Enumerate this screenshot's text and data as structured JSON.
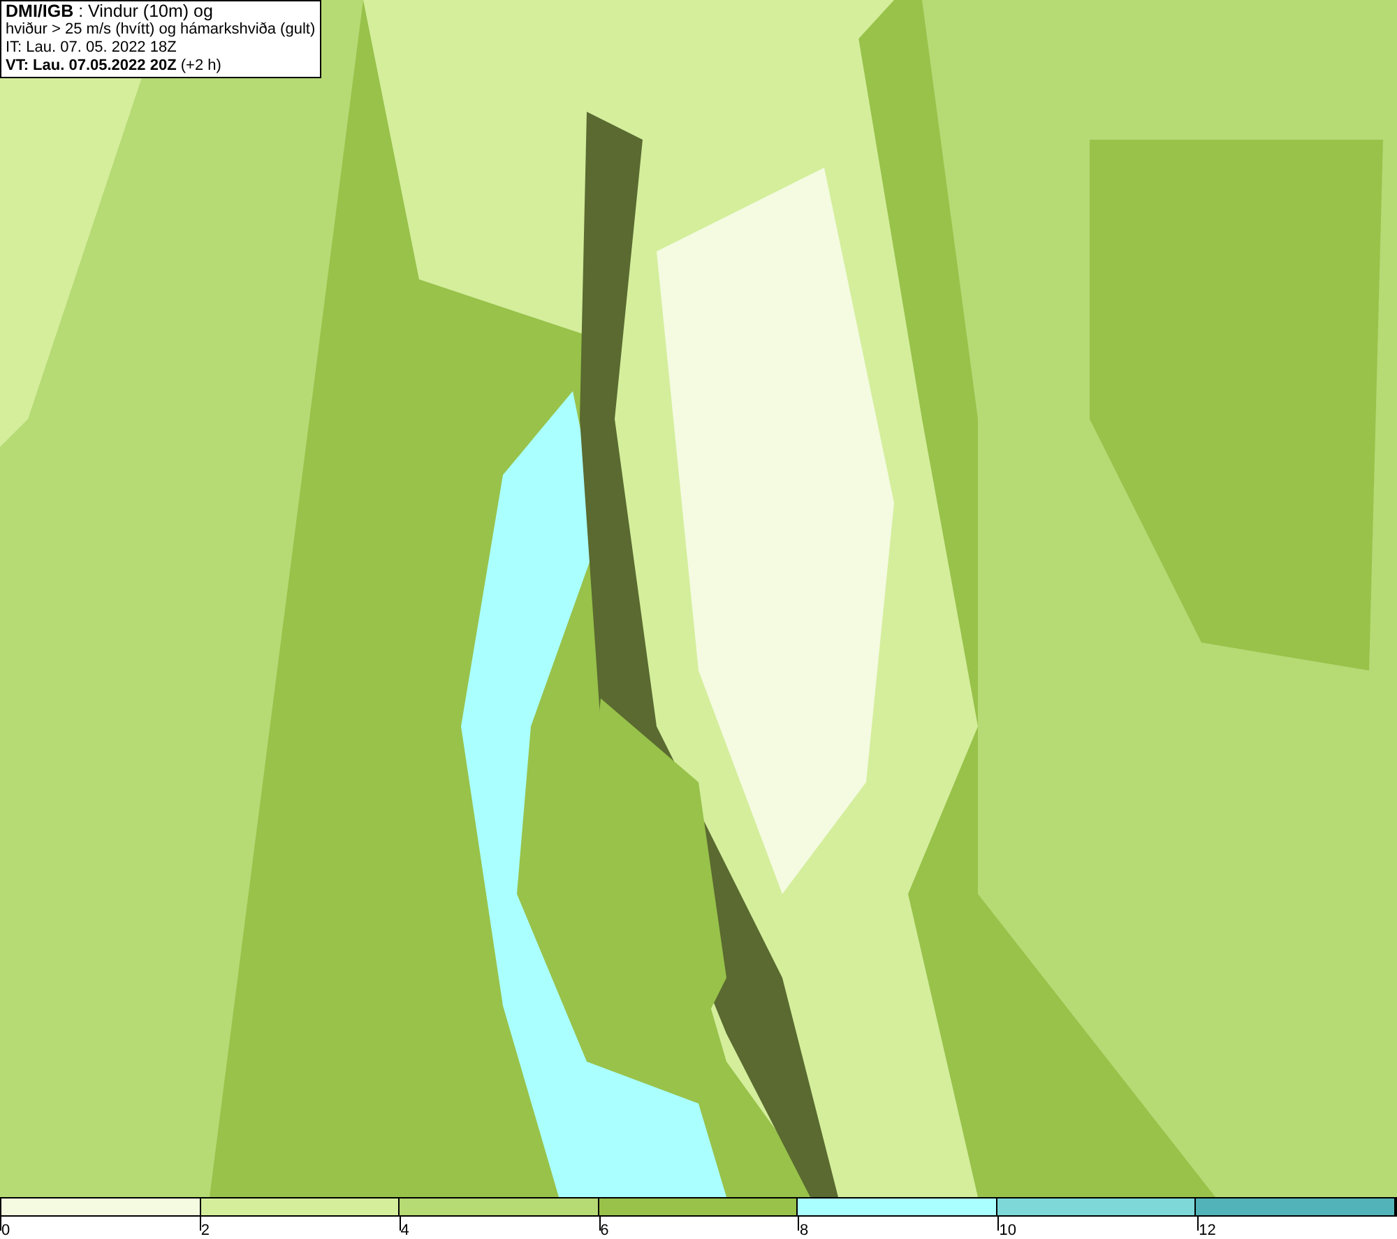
{
  "info_box": {
    "lines": [
      "**DMI/IGB** : Vindur (10m) og",
      "hviður > 25 m/s (hvítt) og hámarkshviða (gult)",
      "IT: Lau. 07. 05. 2022 18Z",
      "**VT: Lau. 07.05.2022 20Z** (+2 h)"
    ]
  },
  "legend": {
    "bins": [
      {
        "color": "#f4fbe0"
      },
      {
        "color": "#d4ee9c"
      },
      {
        "color": "#b6da74"
      },
      {
        "color": "#98c24a"
      },
      {
        "color": "#aaffff"
      },
      {
        "color": "#7ed8d8"
      },
      {
        "color": "#52b4b8"
      }
    ],
    "ticks": [
      "0",
      "2",
      "4",
      "6",
      "8",
      "10",
      "12"
    ]
  }
}
